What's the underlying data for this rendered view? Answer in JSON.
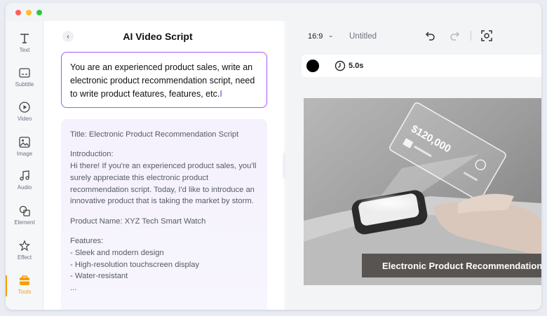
{
  "window": {
    "controls": [
      "close",
      "minimize",
      "maximize"
    ]
  },
  "rail": {
    "items": [
      {
        "label": "Text",
        "icon": "text-icon"
      },
      {
        "label": "Subtitle",
        "icon": "subtitle-icon"
      },
      {
        "label": "Video",
        "icon": "video-icon"
      },
      {
        "label": "Image",
        "icon": "image-icon"
      },
      {
        "label": "Audio",
        "icon": "audio-icon"
      },
      {
        "label": "Element",
        "icon": "element-icon"
      },
      {
        "label": "Effect",
        "icon": "effect-icon"
      },
      {
        "label": "Tools",
        "icon": "tools-icon",
        "active": true
      }
    ]
  },
  "panel": {
    "title": "AI Video Script",
    "prompt": "You are an experienced product sales, write an electronic product recommendation script, need to write product features, features, etc.",
    "result": {
      "title_line": "Title: Electronic Product Recommendation Script",
      "intro_heading": "Introduction:",
      "intro_body": "Hi there! If you're an experienced product sales, you'll surely appreciate this electronic product recommendation script. Today, I'd like to introduce an innovative product that is taking the market by storm.",
      "product_name": "Product Name: XYZ Tech Smart Watch",
      "features_heading": "Features:",
      "features": [
        "- Sleek and modern design",
        "- High-resolution touchscreen display",
        "- Water-resistant"
      ],
      "more": "..."
    }
  },
  "preview": {
    "ratio": "16:9",
    "doc_title": "Untitled",
    "duration": "5.0s",
    "color_swatch": "#000000",
    "hologram_amount": "$120,000",
    "caption": "Electronic Product Recommendation"
  },
  "colors": {
    "accent": "#a855f7",
    "tools_active": "#f59e0b"
  }
}
